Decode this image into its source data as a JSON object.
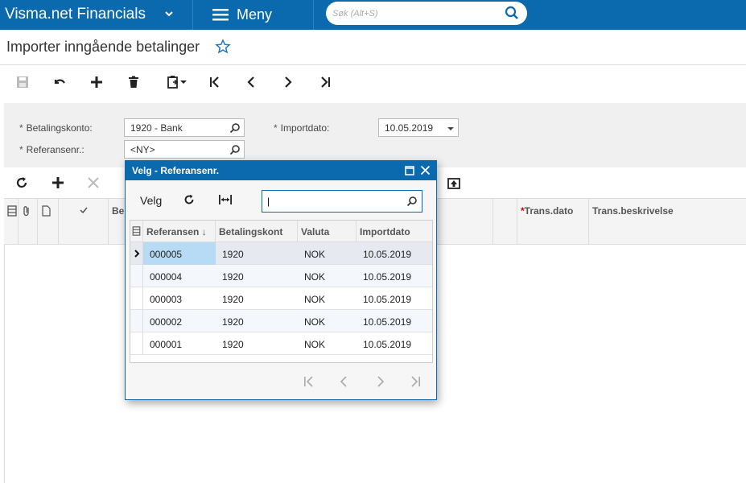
{
  "app": {
    "brand": "Visma.net Financials",
    "menu_label": "Meny",
    "search_placeholder": "Søk (Alt+S)"
  },
  "page": {
    "title": "Importer inngående betalinger"
  },
  "toolbar": {
    "icons": [
      "save-icon",
      "undo-icon",
      "add-icon",
      "delete-icon",
      "clipboard-icon",
      "first-icon",
      "prev-icon",
      "next-icon",
      "last-icon"
    ]
  },
  "form": {
    "betalingskonto_label": "Betalingskonto:",
    "betalingskonto_value": "1920 - Bank",
    "referanse_label": "Referansenr.:",
    "referanse_value": "<NY>",
    "importdato_label": "Importdato:",
    "importdato_value": "10.05.2019",
    "required_mark": "*"
  },
  "grid": {
    "columns": {
      "be": "Be",
      "trans_dato": "Trans.dato",
      "trans_beskrivelse": "Trans.beskrivelse"
    }
  },
  "dialog": {
    "title": "Velg - Referansenr.",
    "select_label": "Velg",
    "search_value": "|",
    "columns": [
      "Referansen",
      "Betalingskont",
      "Valuta",
      "Importdato"
    ],
    "sort_indicator": "↓",
    "rows": [
      {
        "ref": "000005",
        "konto": "1920",
        "valuta": "NOK",
        "dato": "10.05.2019"
      },
      {
        "ref": "000004",
        "konto": "1920",
        "valuta": "NOK",
        "dato": "10.05.2019"
      },
      {
        "ref": "000003",
        "konto": "1920",
        "valuta": "NOK",
        "dato": "10.05.2019"
      },
      {
        "ref": "000002",
        "konto": "1920",
        "valuta": "NOK",
        "dato": "10.05.2019"
      },
      {
        "ref": "000001",
        "konto": "1920",
        "valuta": "NOK",
        "dato": "10.05.2019"
      }
    ]
  },
  "colors": {
    "topbar": "#0a6aad",
    "accent": "#0a6aad",
    "selected_cell": "#b7dbf5"
  }
}
